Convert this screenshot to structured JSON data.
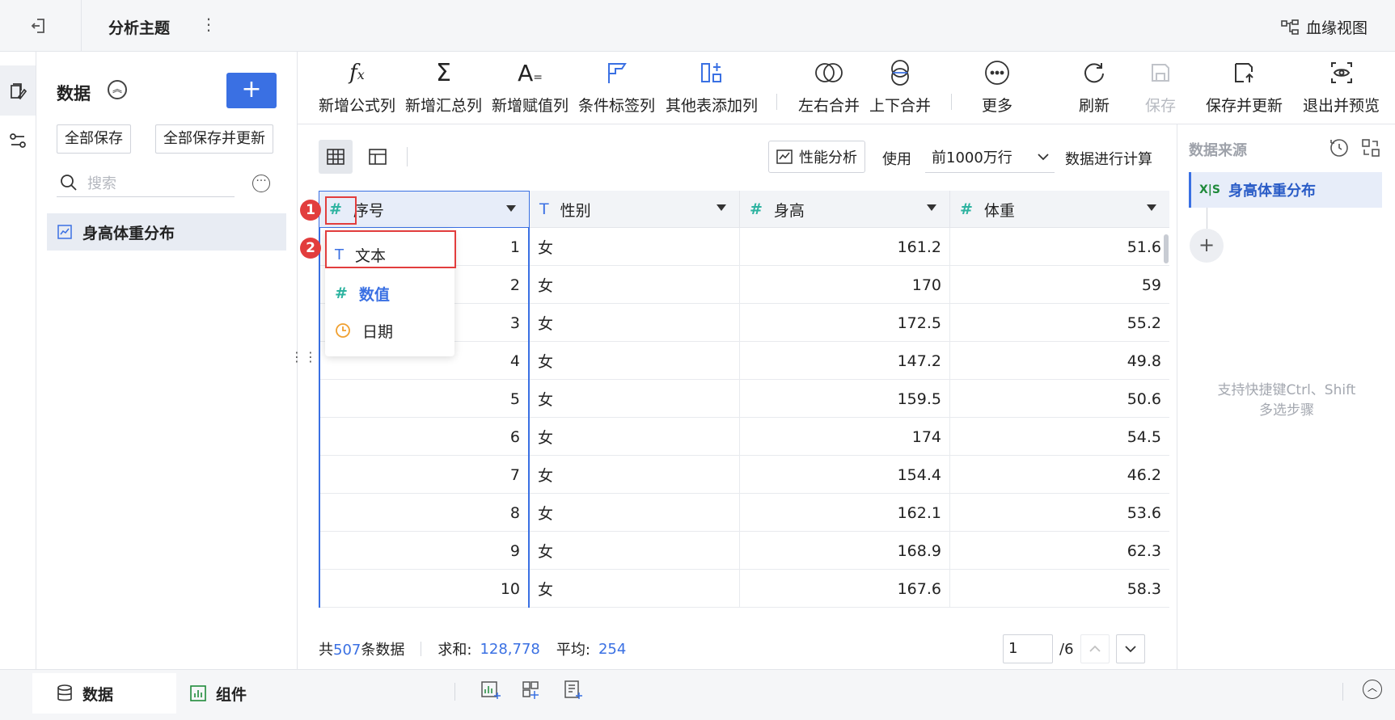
{
  "topbar": {
    "title": "分析主题",
    "lineage": "血缘视图"
  },
  "data_panel": {
    "title": "数据",
    "add_label": "+",
    "save_all": "全部保存",
    "save_all_update": "全部保存并更新",
    "search_placeholder": "搜索",
    "tree_item": "身高体重分布"
  },
  "toolbar": {
    "formula": "新增公式列",
    "summary": "新增汇总列",
    "assign": "新增赋值列",
    "condition": "条件标签列",
    "other": "其他表添加列",
    "lr_merge": "左右合并",
    "ud_merge": "上下合并",
    "more": "更多",
    "refresh": "刷新",
    "save": "保存",
    "save_update": "保存并更新",
    "exit_preview": "退出并预览"
  },
  "viewbar": {
    "perf": "性能分析",
    "use": "使用",
    "rows": "前1000万行",
    "calc": "数据进行计算"
  },
  "grid": {
    "columns": [
      {
        "name": "序号",
        "type_icon": "#"
      },
      {
        "name": "性别",
        "type_icon": "T"
      },
      {
        "name": "身高",
        "type_icon": "#"
      },
      {
        "name": "体重",
        "type_icon": "#"
      }
    ],
    "rows": [
      [
        "1",
        "女",
        "161.2",
        "51.6"
      ],
      [
        "2",
        "女",
        "170",
        "59"
      ],
      [
        "3",
        "女",
        "172.5",
        "55.2"
      ],
      [
        "4",
        "女",
        "147.2",
        "49.8"
      ],
      [
        "5",
        "女",
        "159.5",
        "50.6"
      ],
      [
        "6",
        "女",
        "174",
        "54.5"
      ],
      [
        "7",
        "女",
        "154.4",
        "46.2"
      ],
      [
        "8",
        "女",
        "162.1",
        "53.6"
      ],
      [
        "9",
        "女",
        "168.9",
        "62.3"
      ],
      [
        "10",
        "女",
        "167.6",
        "58.3"
      ]
    ]
  },
  "type_menu": {
    "text": "文本",
    "number": "数值",
    "date": "日期"
  },
  "badges": {
    "one": "1",
    "two": "2"
  },
  "footer": {
    "total_prefix": "共",
    "total_count": "507",
    "total_suffix": "条数据",
    "sum_label": "求和:",
    "sum_value": "128,778",
    "avg_label": "平均:",
    "avg_value": "254",
    "page": "1",
    "page_total": "/6"
  },
  "side_panel": {
    "title": "数据来源",
    "source_icon": "X|S",
    "source": "身高体重分布",
    "hint_line1": "支持快捷键Ctrl、Shift",
    "hint_line2": "多选步骤"
  },
  "bottom": {
    "data_tab": "数据",
    "component_tab": "组件"
  },
  "colors": {
    "accent": "#3a70e3",
    "highlight": "#e23d3d",
    "number_icon": "#2db3a0",
    "date_icon": "#f0a030"
  }
}
